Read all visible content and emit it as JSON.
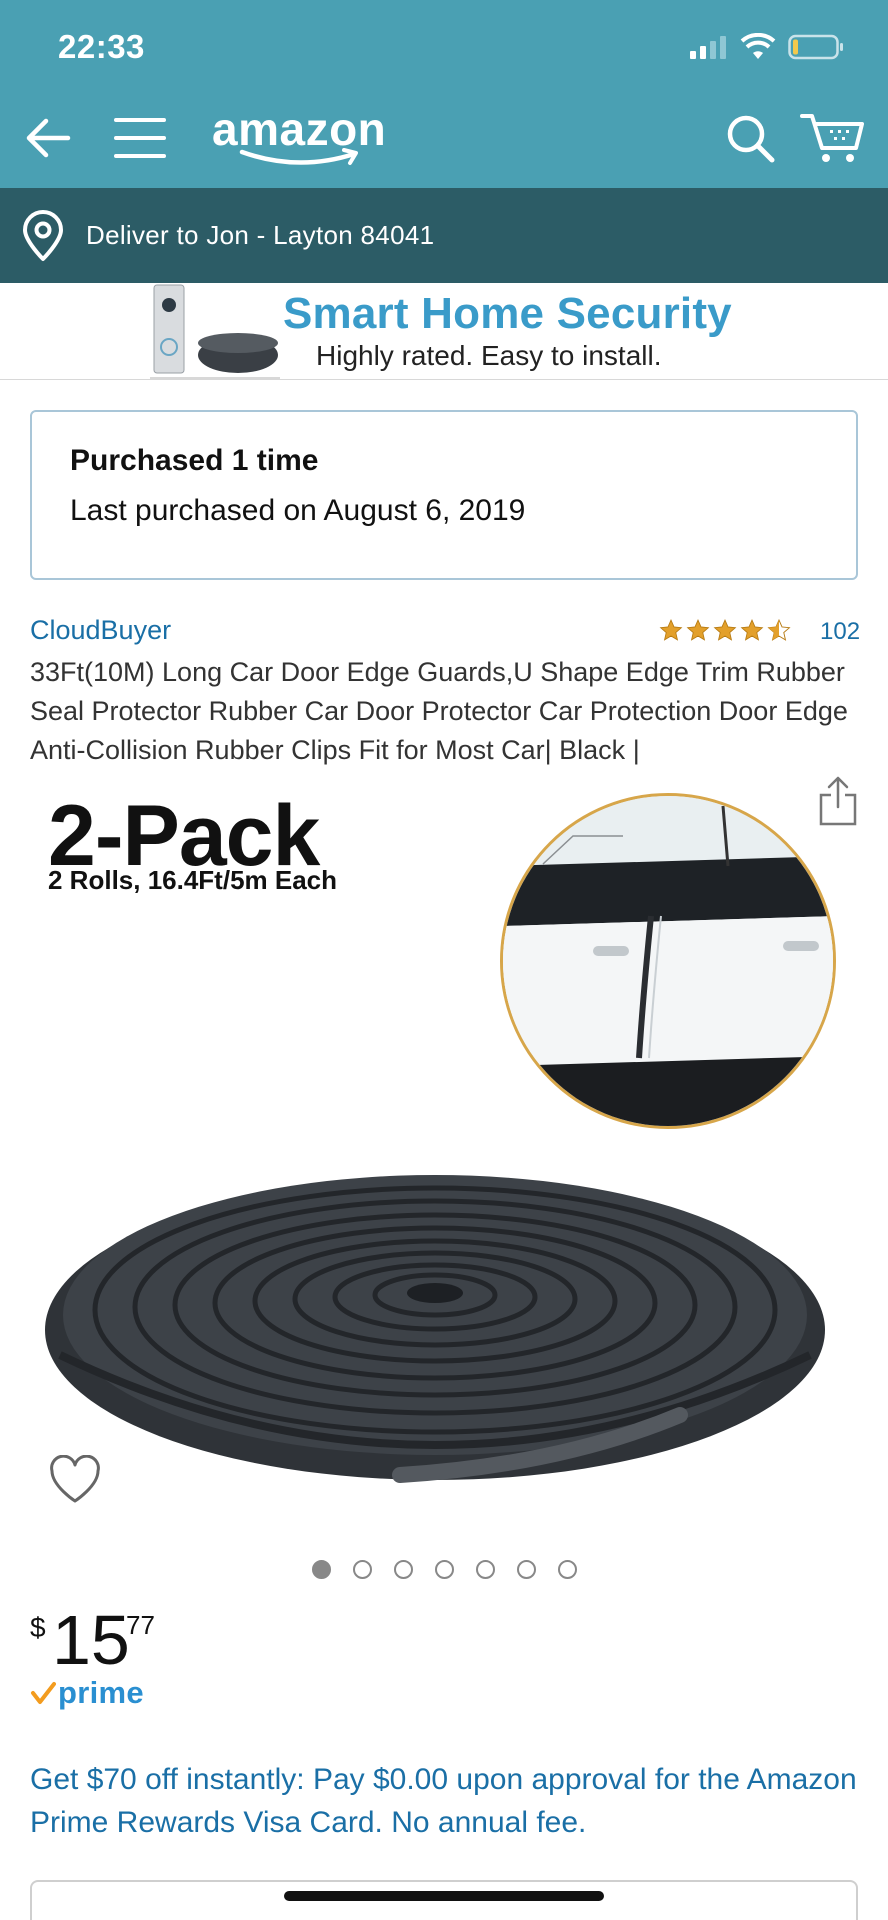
{
  "status_bar": {
    "time": "22:33"
  },
  "header": {
    "logo_text": "amazon",
    "bg_color": "#4aa0b3"
  },
  "deliver": {
    "text": "Deliver to Jon - Layton 84041"
  },
  "banner": {
    "title": "Smart Home Security",
    "subtitle": "Highly rated. Easy to install."
  },
  "purchase_history": {
    "count_text": "Purchased 1 time",
    "last_text": "Last purchased on August 6, 2019"
  },
  "product": {
    "brand": "CloudBuyer",
    "rating": 4.5,
    "review_count": "102",
    "title": "33Ft(10M) Long Car Door Edge Guards,U Shape Edge Trim Rubber Seal Protector Rubber Car Door Protector Car Protection Door Edge Anti-Collision Rubber Clips Fit for Most Car| Black |",
    "image_headline": "2-Pack",
    "image_subline": "2 Rolls, 16.4Ft/5m Each",
    "image_count": 7,
    "active_image": 1
  },
  "price": {
    "currency": "$",
    "whole": "15",
    "fraction": "77",
    "prime_label": "prime"
  },
  "offer": {
    "text": "Get $70 off instantly: Pay $0.00 upon approval for the Amazon Prime Rewards Visa Card. No annual fee."
  },
  "colors": {
    "link": "#1a6fa6",
    "star": "#e3a02b",
    "deliver_bg": "#2c5c66"
  }
}
